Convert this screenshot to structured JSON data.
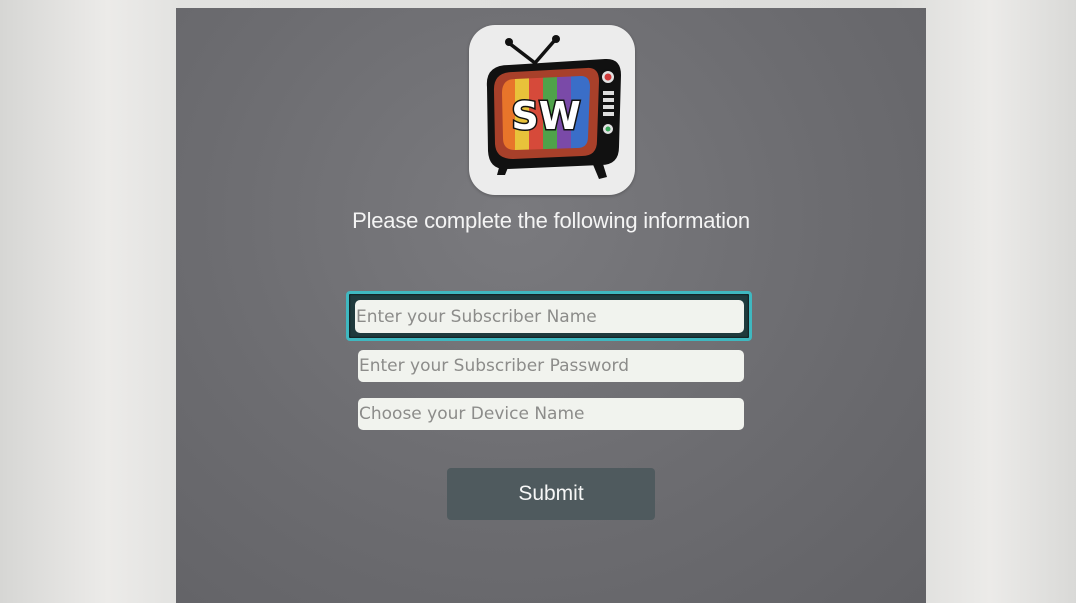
{
  "app": {
    "logo_text": "SW",
    "heading": "Please complete the following information"
  },
  "form": {
    "subscriber_name_placeholder": "Enter your Subscriber Name",
    "subscriber_password_placeholder": "Enter your Subscriber Password",
    "device_name_placeholder": "Choose your Device Name",
    "submit_label": "Submit",
    "focused_field": "subscriber_name"
  },
  "colors": {
    "screen_background": "#6c6c70",
    "focus_ring": "#3fb8c0",
    "field_background": "#f1f3ee",
    "submit_background": "#4f5a5e"
  }
}
